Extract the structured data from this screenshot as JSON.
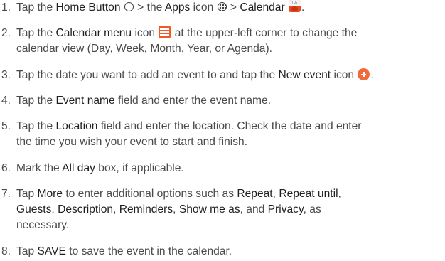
{
  "steps": [
    {
      "n": "1.",
      "a": "Tap the ",
      "b1": "Home Button",
      "c": " > the ",
      "b2": "Apps",
      "d": " icon ",
      "e": " > ",
      "b3": "Calendar",
      "f": ".",
      "icons": {
        "home": "home-button-circle-icon",
        "apps": "apps-grid-icon",
        "calendar": "calendar-app-icon"
      },
      "calendar_icon_text": "TUE"
    },
    {
      "n": "2.",
      "a": "Tap the ",
      "b1": "Calendar menu",
      "c": " icon ",
      "d": " at the upper-left corner to change the",
      "line2": "calendar view (Day, Week, Month, Year, or Agenda).",
      "icons": {
        "menu": "calendar-menu-icon"
      }
    },
    {
      "n": "3.",
      "a": "Tap the date you want to add an event to and tap the ",
      "b1": "New event",
      "c": " icon ",
      "d": ".",
      "icons": {
        "new_event": "new-event-plus-icon"
      }
    },
    {
      "n": "4.",
      "a": "Tap the ",
      "b1": "Event name",
      "c": " field and enter the event name."
    },
    {
      "n": "5.",
      "a": "Tap the ",
      "b1": "Location",
      "c": " field and enter the location. Check the date and enter",
      "line2": "the time you wish your event to start and finish."
    },
    {
      "n": "6.",
      "a": "Mark the ",
      "b1": "All day",
      "c": " box, if applicable."
    },
    {
      "n": "7.",
      "a": "Tap ",
      "b1": "More",
      "c": " to enter additional options such as ",
      "b2": "Repeat",
      "d": ", ",
      "b3": "Repeat until",
      "e": ",",
      "line2_b1": "Guests",
      "line2_c": ", ",
      "line2_b2": "Description",
      "line2_d": ", ",
      "line2_b3": "Reminders",
      "line2_e": ", ",
      "line2_b4": "Show me as",
      "line2_f": ", and ",
      "line2_b5": "Privacy",
      "line2_g": ", as",
      "line3": "necessary."
    },
    {
      "n": "8.",
      "a": "Tap ",
      "b1": "SAVE",
      "c": " to save the event in the calendar."
    }
  ],
  "colors": {
    "text": "#4a4a4a",
    "emphasis": "#1f1f1f",
    "accent_orange": "#f15a24"
  }
}
